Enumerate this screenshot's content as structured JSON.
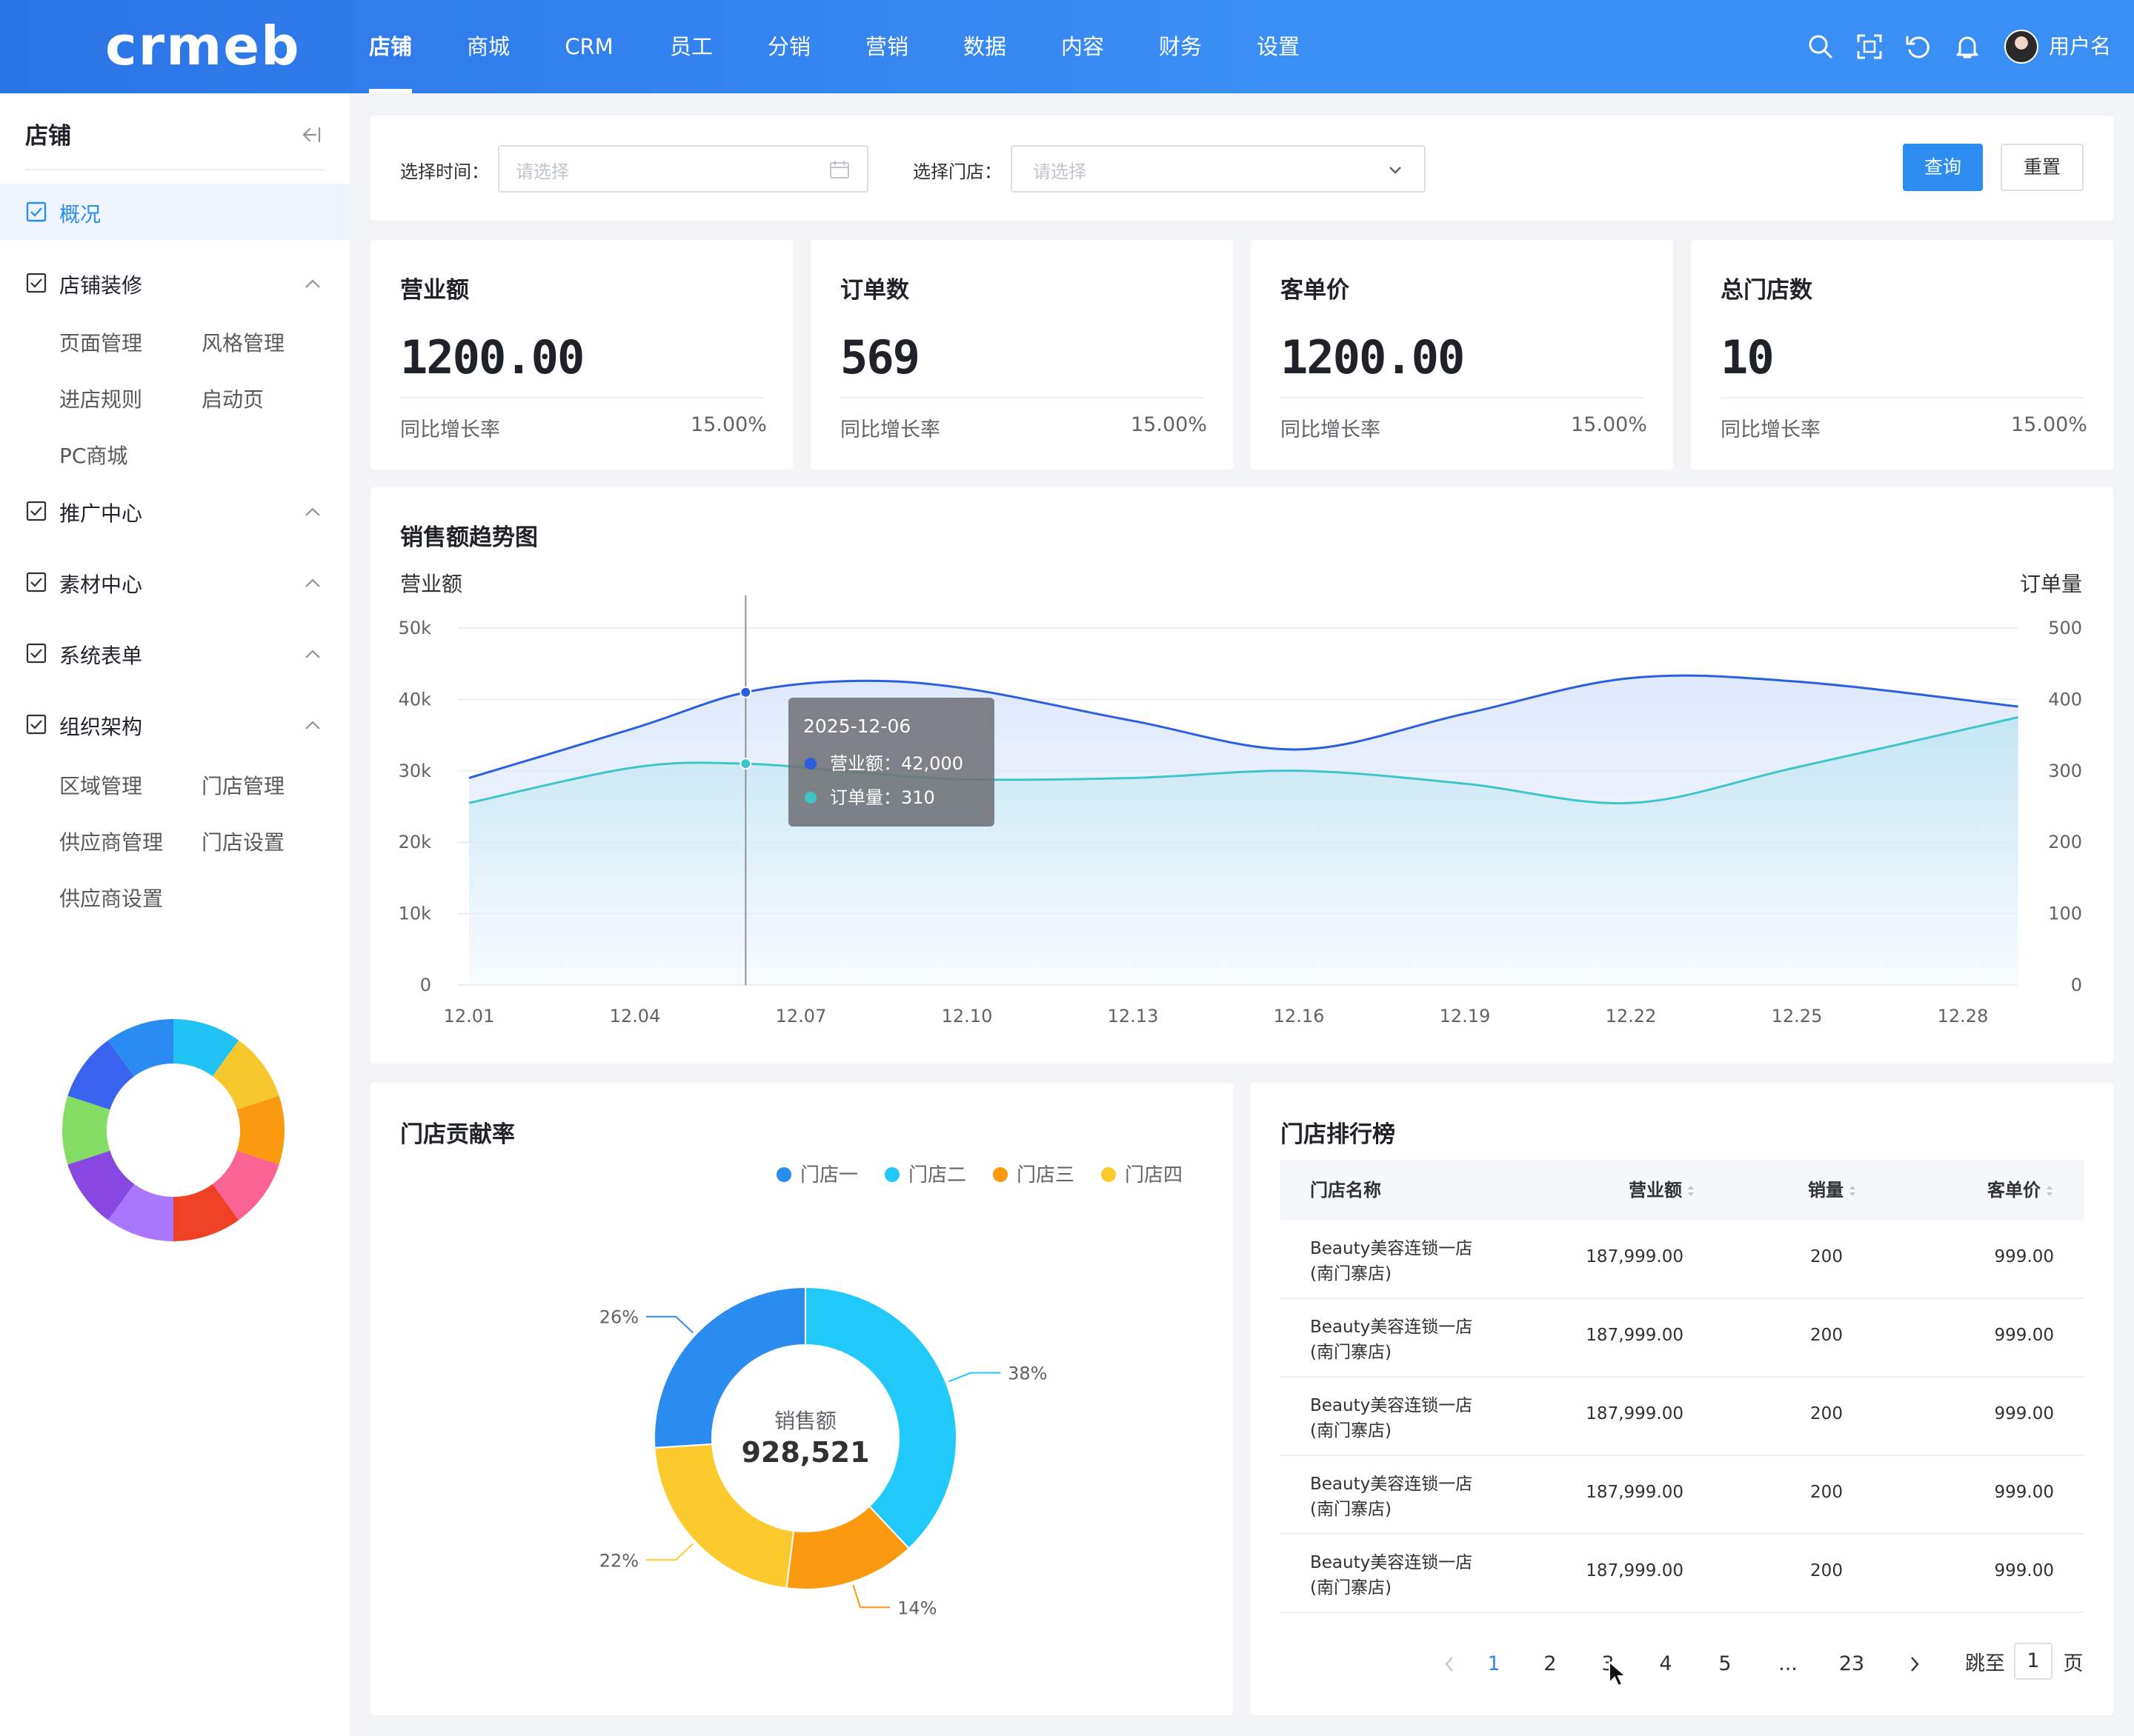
{
  "header": {
    "logo_text": "crmeb",
    "nav": [
      "店铺",
      "商城",
      "CRM",
      "员工",
      "分销",
      "营销",
      "数据",
      "内容",
      "财务",
      "设置"
    ],
    "active_nav": "店铺",
    "username": "用户名",
    "icons": [
      "search-icon",
      "fullscreen-icon",
      "refresh-icon",
      "bell-icon"
    ]
  },
  "sidebar": {
    "title": "店铺",
    "groups": [
      {
        "label": "概况",
        "active": true,
        "children": []
      },
      {
        "label": "店铺装修",
        "expanded": true,
        "children": [
          "页面管理",
          "风格管理",
          "进店规则",
          "启动页",
          "PC商城"
        ]
      },
      {
        "label": "推广中心",
        "expanded": true,
        "children": []
      },
      {
        "label": "素材中心",
        "expanded": true,
        "children": []
      },
      {
        "label": "系统表单",
        "expanded": true,
        "children": []
      },
      {
        "label": "组织架构",
        "expanded": true,
        "children": [
          "区域管理",
          "门店管理",
          "供应商管理",
          "门店设置",
          "供应商设置"
        ]
      }
    ],
    "decor_colors": [
      "#21c3f5",
      "#f7c72e",
      "#fb9a0e",
      "#fb6492",
      "#ef4124",
      "#a977fd",
      "#8748e1",
      "#84dc64",
      "#3a63f0",
      "#2a8cf0"
    ]
  },
  "filters": {
    "time_label": "选择时间：",
    "time_placeholder": "请选择",
    "store_label": "选择门店：",
    "store_placeholder": "请选择",
    "query_button": "查询",
    "reset_button": "重置"
  },
  "stats": [
    {
      "title": "营业额",
      "value": "1200.00",
      "foot_label": "同比增长率",
      "foot_value": "15.00%"
    },
    {
      "title": "订单数",
      "value": "569",
      "foot_label": "同比增长率",
      "foot_value": "15.00%"
    },
    {
      "title": "客单价",
      "value": "1200.00",
      "foot_label": "同比增长率",
      "foot_value": "15.00%"
    },
    {
      "title": "总门店数",
      "value": "10",
      "foot_label": "同比增长率",
      "foot_value": "15.00%"
    }
  ],
  "trend": {
    "title": "销售额趋势图",
    "tooltip": {
      "date": "2025-12-06",
      "line1": "营业额：42,000",
      "line2": "订单量：310"
    }
  },
  "contrib": {
    "title": "门店贡献率",
    "center_label": "销售额",
    "center_value": "928,521"
  },
  "rank": {
    "title": "门店排行榜",
    "columns": [
      "门店名称",
      "营业额",
      "销量",
      "客单价"
    ],
    "rows": [
      {
        "name1": "Beauty美容连锁一店",
        "name2": "(南门寨店)",
        "revenue": "187,999.00",
        "sales": "200",
        "price": "999.00"
      },
      {
        "name1": "Beauty美容连锁一店",
        "name2": "(南门寨店)",
        "revenue": "187,999.00",
        "sales": "200",
        "price": "999.00"
      },
      {
        "name1": "Beauty美容连锁一店",
        "name2": "(南门寨店)",
        "revenue": "187,999.00",
        "sales": "200",
        "price": "999.00"
      },
      {
        "name1": "Beauty美容连锁一店",
        "name2": "(南门寨店)",
        "revenue": "187,999.00",
        "sales": "200",
        "price": "999.00"
      },
      {
        "name1": "Beauty美容连锁一店",
        "name2": "(南门寨店)",
        "revenue": "187,999.00",
        "sales": "200",
        "price": "999.00"
      }
    ],
    "pagination": {
      "pages": [
        "1",
        "2",
        "3",
        "4",
        "5",
        "...",
        "23"
      ],
      "current": "1",
      "jump_label": "跳至",
      "jump_value": "1",
      "page_unit": "页"
    }
  },
  "chart_data": [
    {
      "type": "line",
      "title": "销售额趋势图",
      "ylabel": "营业额",
      "y2label": "订单量",
      "x_ticks": [
        "12.01",
        "12.04",
        "12.07",
        "12.10",
        "12.13",
        "12.16",
        "12.19",
        "12.22",
        "12.25",
        "12.28"
      ],
      "ylim": [
        0,
        50000
      ],
      "y_ticks": [
        "0",
        "10k",
        "20k",
        "30k",
        "40k",
        "50k"
      ],
      "y2lim": [
        0,
        500
      ],
      "y2_ticks": [
        "0",
        "100",
        "200",
        "300",
        "400",
        "500"
      ],
      "series": [
        {
          "name": "营业额",
          "axis": "left",
          "color": "#2b5fe0",
          "x": [
            "12.01",
            "12.04",
            "12.06",
            "12.08",
            "12.10",
            "12.13",
            "12.16",
            "12.19",
            "12.22",
            "12.25",
            "12.29"
          ],
          "values": [
            29000,
            36000,
            41000,
            42600,
            41500,
            37000,
            33000,
            38000,
            43000,
            42500,
            39000
          ]
        },
        {
          "name": "订单量",
          "axis": "right",
          "color": "#3fc5c9",
          "x": [
            "12.01",
            "12.04",
            "12.06",
            "12.08",
            "12.10",
            "12.13",
            "12.16",
            "12.19",
            "12.22",
            "12.25",
            "12.29"
          ],
          "values": [
            255,
            305,
            310,
            298,
            288,
            290,
            300,
            282,
            255,
            305,
            375
          ]
        }
      ],
      "grid": true
    },
    {
      "type": "pie",
      "title": "门店贡献率",
      "legend_position": "top-right",
      "series": [
        {
          "name": "门店一",
          "value": 26,
          "label": "26%",
          "color": "#2b8cf0"
        },
        {
          "name": "门店二",
          "value": 38,
          "label": "38%",
          "color": "#21c9fb"
        },
        {
          "name": "门店三",
          "value": 14,
          "label": "14%",
          "color": "#fb9a0e"
        },
        {
          "name": "门店四",
          "value": 22,
          "label": "22%",
          "color": "#fdca2e"
        }
      ],
      "draw_order": [
        "门店二",
        "门店三",
        "门店四",
        "门店一"
      ]
    }
  ]
}
